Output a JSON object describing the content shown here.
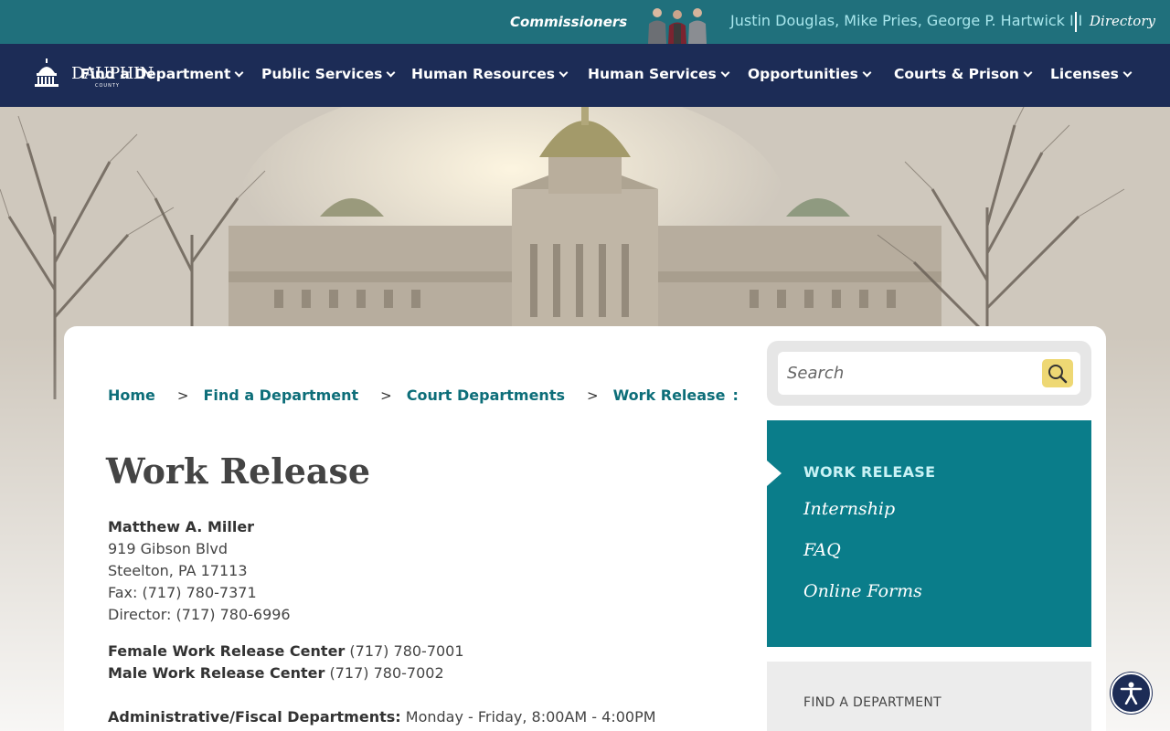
{
  "topbar": {
    "commissioners_label": "Commissioners",
    "commissioner_names": "Justin Douglas, Mike Pries, George P. Hartwick III",
    "directory_label": "Directory"
  },
  "logo": {
    "name": "DAUPHIN",
    "sub": "COUNTY"
  },
  "nav": {
    "items": [
      {
        "label": "Find a Department"
      },
      {
        "label": "Public Services"
      },
      {
        "label": "Human Resources"
      },
      {
        "label": "Human Services"
      },
      {
        "label": "Opportunities"
      },
      {
        "label": "Courts & Prison"
      },
      {
        "label": "Licenses"
      }
    ]
  },
  "breadcrumb": {
    "items": [
      {
        "label": "Home"
      },
      {
        "label": "Find a Department"
      },
      {
        "label": "Court Departments"
      },
      {
        "label": "Work Release"
      }
    ],
    "separator": ">",
    "trailing": ":"
  },
  "page": {
    "title": "Work Release"
  },
  "contact": {
    "name": "Matthew A. Miller",
    "address1": "919 Gibson Blvd",
    "address2": "Steelton, PA  17113",
    "fax": "Fax: (717) 780-7371",
    "director": "Director: (717) 780-6996",
    "female_center_label": "Female Work Release Center",
    "female_center_phone": " (717) 780-7001",
    "male_center_label": "Male Work Release Center",
    "male_center_phone": " (717) 780-7002",
    "admin_label": "Administrative/Fiscal Departments:",
    "admin_hours": " Monday - Friday, 8:00AM - 4:00PM"
  },
  "search": {
    "placeholder": "Search"
  },
  "subnav": {
    "current": "WORK RELEASE",
    "links": [
      {
        "label": "Internship"
      },
      {
        "label": "FAQ"
      },
      {
        "label": "Online Forms"
      }
    ]
  },
  "find_department": {
    "label": "FIND A DEPARTMENT"
  },
  "colors": {
    "topbar": "#20707c",
    "navbar": "#1c2c56",
    "accent": "#0a7d8a",
    "link": "#0d6e79",
    "search_button": "#eed874"
  }
}
